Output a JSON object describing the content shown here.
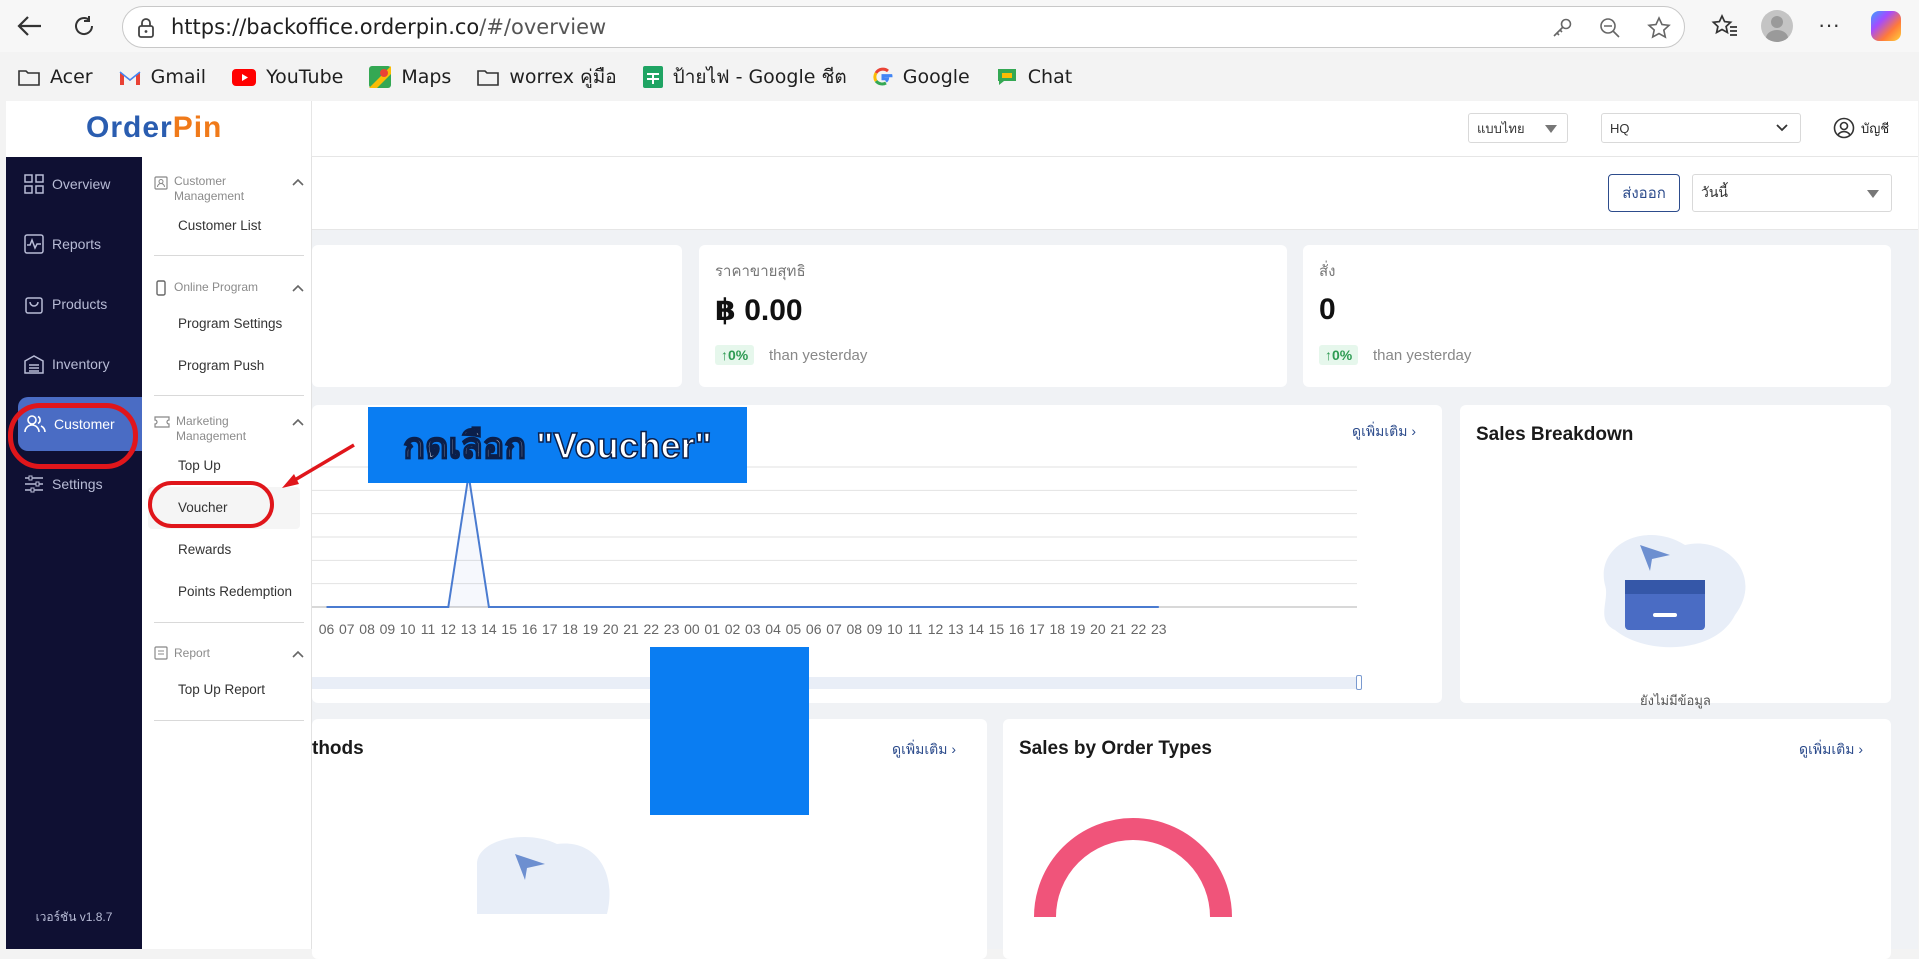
{
  "browser": {
    "url_host": "https://backoffice.orderpin.co",
    "url_path": "/#/overview",
    "bookmarks": [
      {
        "label": "Acer",
        "icon": "folder-icon"
      },
      {
        "label": "Gmail",
        "icon": "gmail-icon"
      },
      {
        "label": "YouTube",
        "icon": "youtube-icon"
      },
      {
        "label": "Maps",
        "icon": "maps-icon"
      },
      {
        "label": "worrex คู่มือ",
        "icon": "folder-icon"
      },
      {
        "label": "ป้ายไฟ - Google ชีต",
        "icon": "sheets-icon"
      },
      {
        "label": "Google",
        "icon": "google-icon"
      },
      {
        "label": "Chat",
        "icon": "chat-icon"
      }
    ]
  },
  "app": {
    "logo": "OrderPin",
    "version": "เวอร์ชัน v1.8.7",
    "language": "แบบไทย",
    "branch": "HQ",
    "account": "บัญชี",
    "export_label": "ส่งออก",
    "date_filter": "วันนี้"
  },
  "sidebar": {
    "items": [
      {
        "label": "Overview",
        "icon": "grid-icon"
      },
      {
        "label": "Reports",
        "icon": "chart-icon"
      },
      {
        "label": "Products",
        "icon": "bag-icon"
      },
      {
        "label": "Inventory",
        "icon": "warehouse-icon"
      },
      {
        "label": "Customer",
        "icon": "users-icon",
        "active": true
      },
      {
        "label": "Settings",
        "icon": "sliders-icon"
      }
    ]
  },
  "submenu": {
    "groups": [
      {
        "title": "Customer Management",
        "items": [
          "Customer List"
        ]
      },
      {
        "title": "Online Program",
        "items": [
          "Program Settings",
          "Program Push"
        ]
      },
      {
        "title": "Marketing Management",
        "items": [
          "Top Up",
          "Voucher",
          "Rewards",
          "Points Redemption"
        ]
      },
      {
        "title": "Report",
        "items": [
          "Top Up Report"
        ]
      }
    ]
  },
  "stats": [
    {
      "label": "ราคาขายสุทธิ",
      "value": "฿ 0.00",
      "change": "↑0%",
      "compare": "than yesterday"
    },
    {
      "label": "สั่ง",
      "value": "0",
      "change": "↑0%",
      "compare": "than yesterday"
    }
  ],
  "annotation": "กดเลือก \"Voucher\"",
  "cards": {
    "more_link": "ดูเพิ่มเติม",
    "sales_breakdown": "Sales Breakdown",
    "no_data": "ยังไม่มีข้อมูล",
    "payment_methods_partial": "thods",
    "sales_by_order_types": "Sales by Order Types"
  },
  "chart_data": {
    "type": "line",
    "x": [
      "06",
      "07",
      "08",
      "09",
      "10",
      "11",
      "12",
      "13",
      "14",
      "15",
      "16",
      "17",
      "18",
      "19",
      "20",
      "21",
      "22",
      "23",
      "00",
      "01",
      "02",
      "03",
      "04",
      "05",
      "06",
      "07",
      "08",
      "09",
      "10",
      "11",
      "12",
      "13",
      "14",
      "15",
      "16",
      "17",
      "18",
      "19",
      "20",
      "21",
      "22",
      "23"
    ],
    "x_visible_left": [
      "06",
      "07",
      "08",
      "09",
      "10",
      "11",
      "12",
      "13",
      "14",
      "15",
      "16",
      "17",
      "18"
    ],
    "x_visible_right": [
      "02",
      "03",
      "04",
      "05",
      "06",
      "07",
      "08",
      "09",
      "10",
      "11",
      "12",
      "13",
      "14",
      "15",
      "16",
      "17",
      "18",
      "19",
      "20",
      "21",
      "22",
      "23"
    ],
    "series": [
      {
        "values": [
          0,
          0,
          0,
          0,
          0,
          0,
          0,
          1,
          0,
          0,
          0,
          0,
          0,
          0,
          0,
          0,
          0,
          0,
          0,
          0,
          0,
          0,
          0,
          0,
          0,
          0,
          0,
          0,
          0,
          0,
          0,
          0,
          0,
          0,
          0,
          0,
          0,
          0,
          0,
          0,
          0,
          0
        ]
      }
    ],
    "colors": {
      "line": "#4a7bd0"
    }
  }
}
